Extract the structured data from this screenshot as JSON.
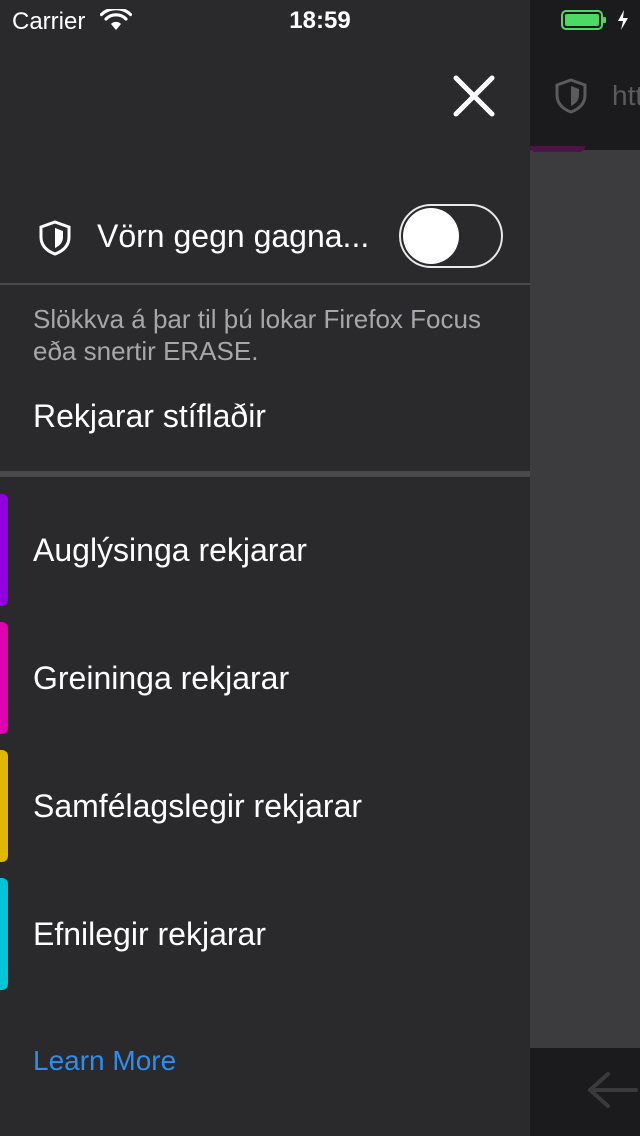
{
  "status_bar": {
    "carrier": "Carrier",
    "time": "18:59"
  },
  "background": {
    "url_fragment": "htt"
  },
  "panel": {
    "toggle": {
      "label": "Vörn gegn gagna...",
      "on": false
    },
    "description": "Slökkva á þar til þú lokar Firefox Focus eða snertir ERASE.",
    "blocked_title": "Rekjarar stíflaðir",
    "trackers": [
      {
        "label": "Auglýsinga rekjarar",
        "color": "#9100e0"
      },
      {
        "label": "Greininga rekjarar",
        "color": "#e000b0"
      },
      {
        "label": "Samfélagslegir rekjarar",
        "color": "#e0b800"
      },
      {
        "label": "Efnilegir rekjarar",
        "color": "#00c4d8"
      }
    ],
    "learn_more": "Learn More"
  },
  "colors": {
    "accent_link": "#2b8ef0",
    "battery": "#4cd964",
    "panel_bg": "#2a2a2c"
  }
}
